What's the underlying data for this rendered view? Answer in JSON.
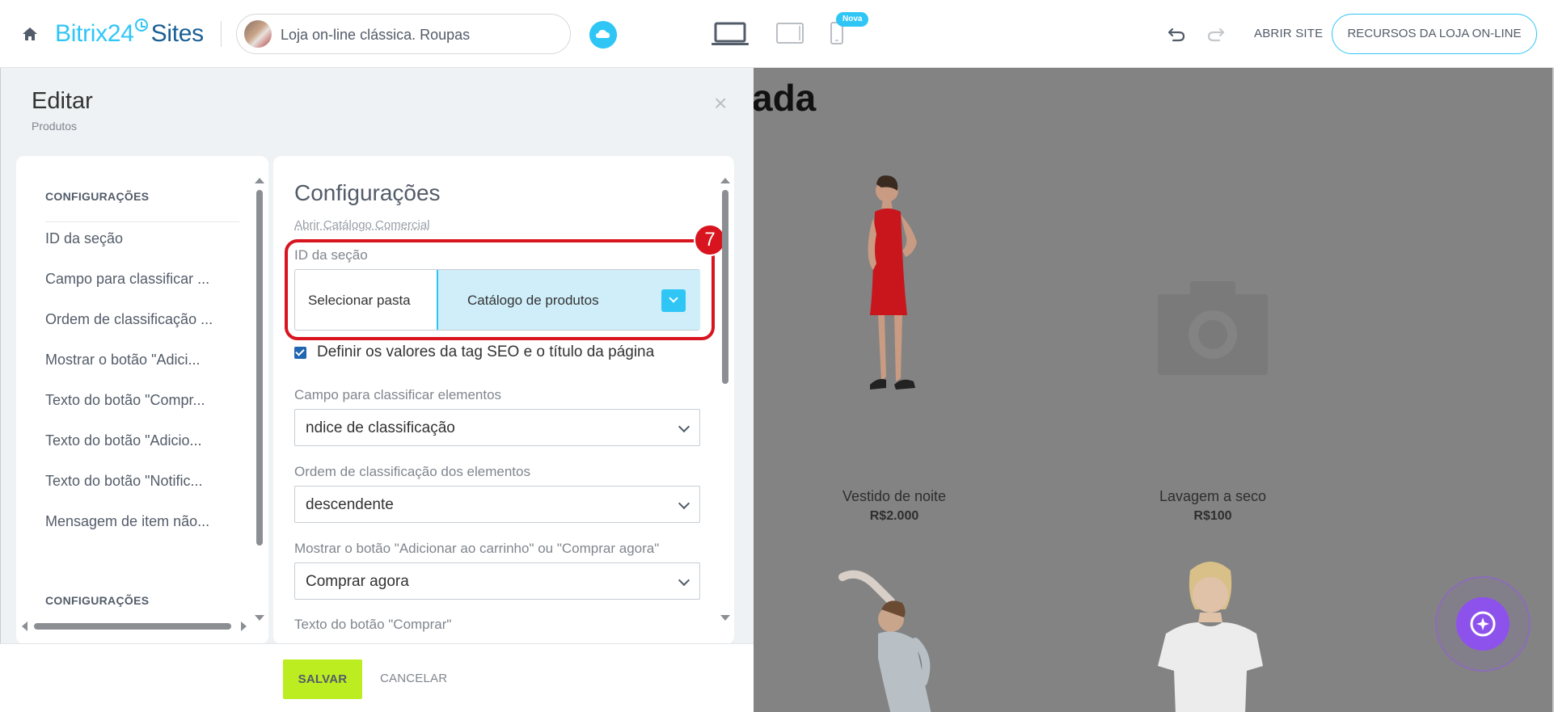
{
  "topbar": {
    "brand_b24": "Bitrix24",
    "brand_sites": "Sites",
    "site_name": "Loja on-line clássica. Roupas",
    "new_badge": "Nova",
    "open_site": "ABRIR SITE",
    "store_resources": "RECURSOS DA LOJA ON-LINE"
  },
  "preview": {
    "heading_fragment": "ada",
    "products": [
      {
        "name": "Vestido de noite",
        "price": "R$2.000"
      },
      {
        "name": "Lavagem a seco",
        "price": "R$100"
      }
    ]
  },
  "panel": {
    "title": "Editar",
    "subtitle": "Produtos",
    "close": "×",
    "left_nav": {
      "section_heading": "CONFIGURAÇÕES",
      "items": [
        "ID da seção",
        "Campo para classificar ...",
        "Ordem de classificação ...",
        "Mostrar o botão \"Adici...",
        "Texto do botão \"Compr...",
        "Texto do botão \"Adicio...",
        "Texto do botão \"Notific...",
        "Mensagem de item não..."
      ],
      "section_heading_2": "CONFIGURAÇÕES"
    },
    "settings": {
      "title": "Configurações",
      "catalog_link": "Abrir Catálogo Comercial",
      "step_number": "7",
      "section_id_label": "ID da seção",
      "select_folder": "Selecionar pasta",
      "selected_folder": "Catálogo de produtos",
      "seo_checkbox_label": "Definir os valores da tag SEO e o título da página",
      "seo_checked": true,
      "sort_field_label": "Campo para classificar elementos",
      "sort_field_value": "ndice de classificação",
      "sort_order_label": "Ordem de classificação dos elementos",
      "sort_order_value": "descendente",
      "show_button_label": "Mostrar o botão \"Adicionar ao carrinho\" ou \"Comprar agora\"",
      "show_button_value": "Comprar agora",
      "buy_text_label": "Texto do botão \"Comprar\""
    },
    "footer": {
      "save": "SALVAR",
      "cancel": "CANCELAR"
    }
  },
  "colors": {
    "accent": "#2fc6f6",
    "highlight": "#d8141f",
    "save_button": "#bbed21",
    "preview_overlay": "#838383",
    "assistant": "#8e52ec"
  },
  "icons": [
    "home-icon",
    "cloud-icon",
    "desktop-icon",
    "tablet-icon",
    "mobile-icon",
    "undo-icon",
    "redo-icon",
    "chevron-down-icon",
    "assistant-icon"
  ]
}
